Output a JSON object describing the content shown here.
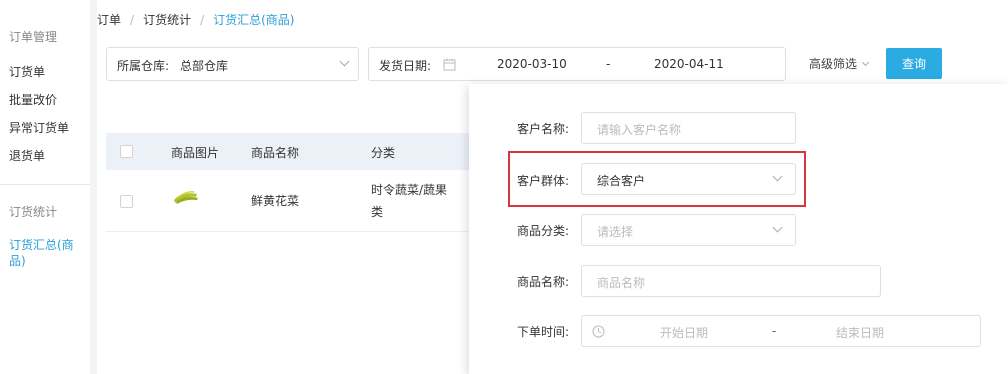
{
  "sidebar": {
    "group1": "订单管理",
    "items": [
      {
        "label": "订货单"
      },
      {
        "label": "批量改价"
      },
      {
        "label": "异常订货单"
      },
      {
        "label": "退货单"
      }
    ],
    "group2": "订货统计",
    "active_item": "订货汇总(商品)"
  },
  "breadcrumb": {
    "items": [
      "订单",
      "订货统计"
    ],
    "separator": "/",
    "current": "订货汇总(商品)"
  },
  "filters": {
    "warehouse_label": "所属仓库:",
    "warehouse_value": "总部仓库",
    "ship_date_label": "发货日期:",
    "date_start": "2020-03-10",
    "date_sep": "-",
    "date_end": "2020-04-11",
    "advanced_label": "高级筛选",
    "query_button": "查询"
  },
  "table": {
    "headers": [
      "商品图片",
      "商品名称",
      "分类"
    ],
    "rows": [
      {
        "name": "鲜黄花菜",
        "category": "时令蔬菜/蔬果类"
      }
    ]
  },
  "advanced_panel": {
    "customer_name_label": "客户名称:",
    "customer_name_placeholder": "请输入客户名称",
    "customer_group_label": "客户群体:",
    "customer_group_value": "综合客户",
    "product_category_label": "商品分类:",
    "product_category_placeholder": "请选择",
    "product_name_label": "商品名称:",
    "product_name_placeholder": "商品名称",
    "order_time_label": "下单时间:",
    "order_time_start": "开始日期",
    "order_time_sep": "-",
    "order_time_end": "结束日期"
  },
  "colors": {
    "accent": "#2b9fd8",
    "button": "#2aace2",
    "highlight": "#d4373d"
  }
}
